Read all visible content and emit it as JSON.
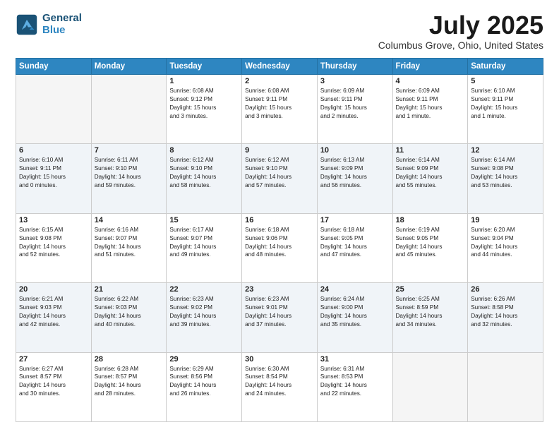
{
  "header": {
    "logo_line1": "General",
    "logo_line2": "Blue",
    "title": "July 2025",
    "subtitle": "Columbus Grove, Ohio, United States"
  },
  "calendar": {
    "days_of_week": [
      "Sunday",
      "Monday",
      "Tuesday",
      "Wednesday",
      "Thursday",
      "Friday",
      "Saturday"
    ],
    "weeks": [
      [
        {
          "day": "",
          "info": ""
        },
        {
          "day": "",
          "info": ""
        },
        {
          "day": "1",
          "info": "Sunrise: 6:08 AM\nSunset: 9:12 PM\nDaylight: 15 hours\nand 3 minutes."
        },
        {
          "day": "2",
          "info": "Sunrise: 6:08 AM\nSunset: 9:11 PM\nDaylight: 15 hours\nand 3 minutes."
        },
        {
          "day": "3",
          "info": "Sunrise: 6:09 AM\nSunset: 9:11 PM\nDaylight: 15 hours\nand 2 minutes."
        },
        {
          "day": "4",
          "info": "Sunrise: 6:09 AM\nSunset: 9:11 PM\nDaylight: 15 hours\nand 1 minute."
        },
        {
          "day": "5",
          "info": "Sunrise: 6:10 AM\nSunset: 9:11 PM\nDaylight: 15 hours\nand 1 minute."
        }
      ],
      [
        {
          "day": "6",
          "info": "Sunrise: 6:10 AM\nSunset: 9:11 PM\nDaylight: 15 hours\nand 0 minutes."
        },
        {
          "day": "7",
          "info": "Sunrise: 6:11 AM\nSunset: 9:10 PM\nDaylight: 14 hours\nand 59 minutes."
        },
        {
          "day": "8",
          "info": "Sunrise: 6:12 AM\nSunset: 9:10 PM\nDaylight: 14 hours\nand 58 minutes."
        },
        {
          "day": "9",
          "info": "Sunrise: 6:12 AM\nSunset: 9:10 PM\nDaylight: 14 hours\nand 57 minutes."
        },
        {
          "day": "10",
          "info": "Sunrise: 6:13 AM\nSunset: 9:09 PM\nDaylight: 14 hours\nand 56 minutes."
        },
        {
          "day": "11",
          "info": "Sunrise: 6:14 AM\nSunset: 9:09 PM\nDaylight: 14 hours\nand 55 minutes."
        },
        {
          "day": "12",
          "info": "Sunrise: 6:14 AM\nSunset: 9:08 PM\nDaylight: 14 hours\nand 53 minutes."
        }
      ],
      [
        {
          "day": "13",
          "info": "Sunrise: 6:15 AM\nSunset: 9:08 PM\nDaylight: 14 hours\nand 52 minutes."
        },
        {
          "day": "14",
          "info": "Sunrise: 6:16 AM\nSunset: 9:07 PM\nDaylight: 14 hours\nand 51 minutes."
        },
        {
          "day": "15",
          "info": "Sunrise: 6:17 AM\nSunset: 9:07 PM\nDaylight: 14 hours\nand 49 minutes."
        },
        {
          "day": "16",
          "info": "Sunrise: 6:18 AM\nSunset: 9:06 PM\nDaylight: 14 hours\nand 48 minutes."
        },
        {
          "day": "17",
          "info": "Sunrise: 6:18 AM\nSunset: 9:05 PM\nDaylight: 14 hours\nand 47 minutes."
        },
        {
          "day": "18",
          "info": "Sunrise: 6:19 AM\nSunset: 9:05 PM\nDaylight: 14 hours\nand 45 minutes."
        },
        {
          "day": "19",
          "info": "Sunrise: 6:20 AM\nSunset: 9:04 PM\nDaylight: 14 hours\nand 44 minutes."
        }
      ],
      [
        {
          "day": "20",
          "info": "Sunrise: 6:21 AM\nSunset: 9:03 PM\nDaylight: 14 hours\nand 42 minutes."
        },
        {
          "day": "21",
          "info": "Sunrise: 6:22 AM\nSunset: 9:03 PM\nDaylight: 14 hours\nand 40 minutes."
        },
        {
          "day": "22",
          "info": "Sunrise: 6:23 AM\nSunset: 9:02 PM\nDaylight: 14 hours\nand 39 minutes."
        },
        {
          "day": "23",
          "info": "Sunrise: 6:23 AM\nSunset: 9:01 PM\nDaylight: 14 hours\nand 37 minutes."
        },
        {
          "day": "24",
          "info": "Sunrise: 6:24 AM\nSunset: 9:00 PM\nDaylight: 14 hours\nand 35 minutes."
        },
        {
          "day": "25",
          "info": "Sunrise: 6:25 AM\nSunset: 8:59 PM\nDaylight: 14 hours\nand 34 minutes."
        },
        {
          "day": "26",
          "info": "Sunrise: 6:26 AM\nSunset: 8:58 PM\nDaylight: 14 hours\nand 32 minutes."
        }
      ],
      [
        {
          "day": "27",
          "info": "Sunrise: 6:27 AM\nSunset: 8:57 PM\nDaylight: 14 hours\nand 30 minutes."
        },
        {
          "day": "28",
          "info": "Sunrise: 6:28 AM\nSunset: 8:57 PM\nDaylight: 14 hours\nand 28 minutes."
        },
        {
          "day": "29",
          "info": "Sunrise: 6:29 AM\nSunset: 8:56 PM\nDaylight: 14 hours\nand 26 minutes."
        },
        {
          "day": "30",
          "info": "Sunrise: 6:30 AM\nSunset: 8:54 PM\nDaylight: 14 hours\nand 24 minutes."
        },
        {
          "day": "31",
          "info": "Sunrise: 6:31 AM\nSunset: 8:53 PM\nDaylight: 14 hours\nand 22 minutes."
        },
        {
          "day": "",
          "info": ""
        },
        {
          "day": "",
          "info": ""
        }
      ]
    ]
  }
}
